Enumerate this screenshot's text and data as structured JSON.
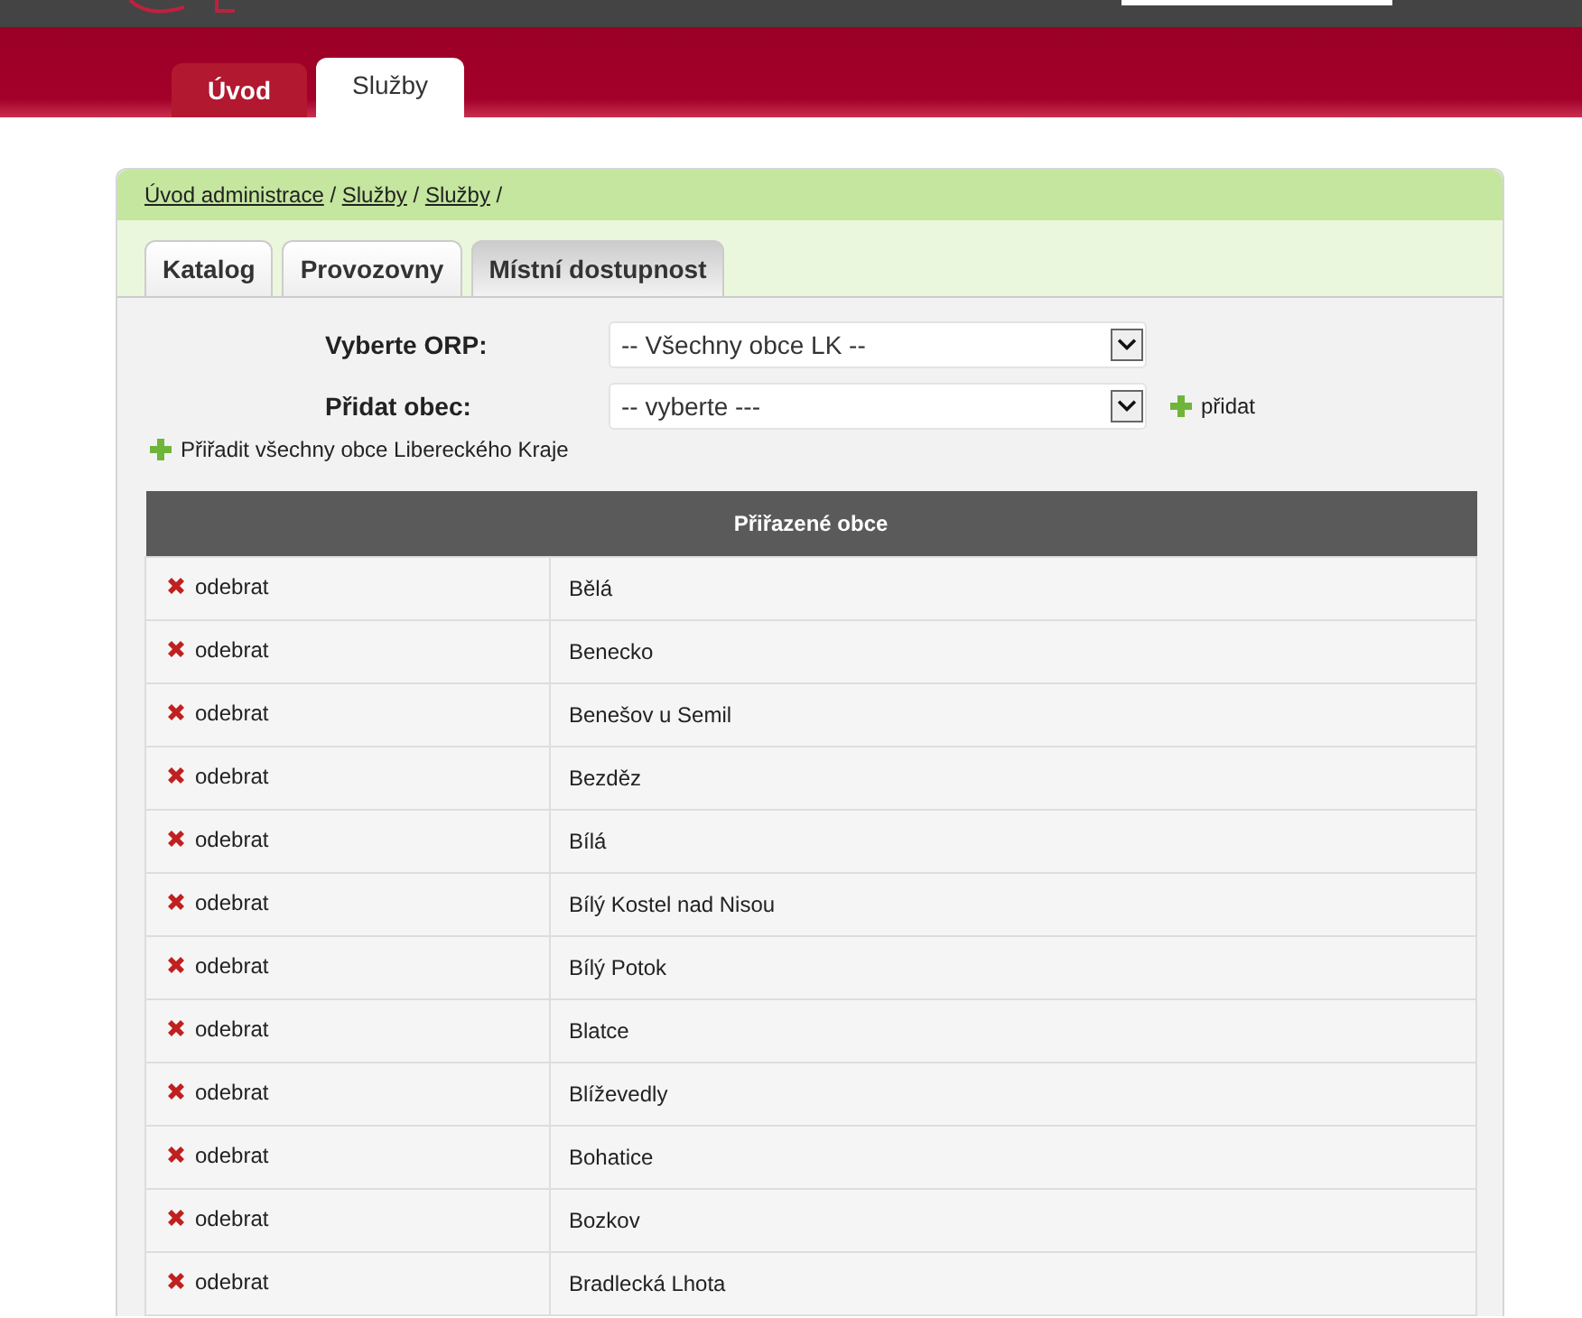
{
  "main_nav": [
    {
      "label": "Úvod",
      "selected": false
    },
    {
      "label": "Služby",
      "selected": true
    }
  ],
  "breadcrumb": {
    "links": [
      "Úvod administrace",
      "Služby",
      "Služby"
    ],
    "separator": "/"
  },
  "tabs": [
    {
      "label": "Katalog",
      "selected": false
    },
    {
      "label": "Provozovny",
      "selected": false
    },
    {
      "label": "Místní dostupnost",
      "selected": true
    }
  ],
  "form": {
    "orp_label": "Vyberte ORP:",
    "orp_value": "-- Všechny obce LK --",
    "obec_label": "Přidat obec:",
    "obec_value": "-- vyberte ---",
    "add_link": "přidat",
    "assign_all_link": "Přiřadit všechny obce Libereckého Kraje"
  },
  "table": {
    "title": "Přiřazené obce",
    "rows": [
      {
        "remove": "odebrat",
        "name": "Bělá"
      },
      {
        "remove": "odebrat",
        "name": "Benecko"
      },
      {
        "remove": "odebrat",
        "name": "Benešov u Semil"
      },
      {
        "remove": "odebrat",
        "name": "Bezděz"
      },
      {
        "remove": "odebrat",
        "name": "Bílá"
      },
      {
        "remove": "odebrat",
        "name": "Bílý Kostel nad Nisou"
      },
      {
        "remove": "odebrat",
        "name": "Bílý Potok"
      },
      {
        "remove": "odebrat",
        "name": "Blatce"
      },
      {
        "remove": "odebrat",
        "name": "Blíževedly"
      },
      {
        "remove": "odebrat",
        "name": "Bohatice"
      },
      {
        "remove": "odebrat",
        "name": "Bozkov"
      },
      {
        "remove": "odebrat",
        "name": "Bradlecká Lhota"
      }
    ]
  }
}
